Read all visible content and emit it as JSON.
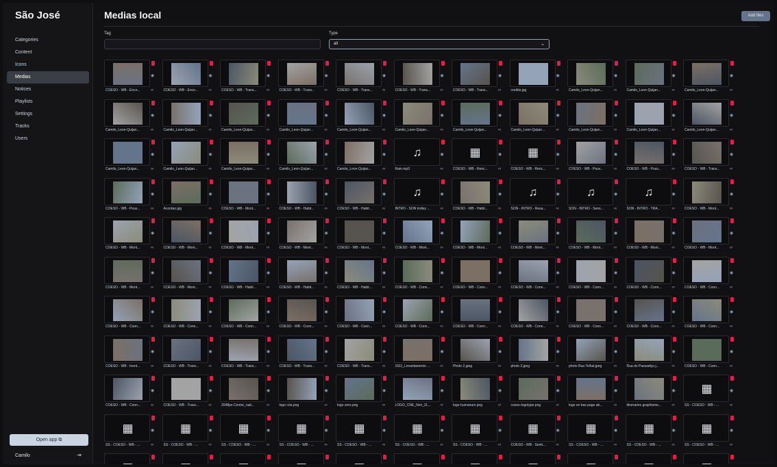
{
  "app": {
    "title": "São José"
  },
  "nav": [
    {
      "label": "Categories",
      "active": false
    },
    {
      "label": "Content",
      "active": false
    },
    {
      "label": "Icons",
      "active": false
    },
    {
      "label": "Medias",
      "active": true
    },
    {
      "label": "Notices",
      "active": false
    },
    {
      "label": "Playlists",
      "active": false
    },
    {
      "label": "Settings",
      "active": false
    },
    {
      "label": "Tracks",
      "active": false
    },
    {
      "label": "Users",
      "active": false
    }
  ],
  "footer": {
    "open_app": "Open app",
    "user": "Camilo"
  },
  "page": {
    "title": "Medias local",
    "add_files": "Add files"
  },
  "filters": {
    "tag_label": "Tag",
    "tag_value": "",
    "type_label": "Type",
    "type_value": "all"
  },
  "media": [
    [
      "COESO - WB - Enco...",
      "COESO - WB - Enco...",
      "COESO - WB - Trans...",
      "COESO - WB - Trans...",
      "COESO - WB - Trans...",
      "COESO - WB - Trans...",
      "COESO - WB - Trans...",
      "credits.jpg",
      "Camilo_Leon-Quijan...",
      "Camilo_Leon-Quijan...",
      "Camilo_Leon-Quijan..."
    ],
    [
      "Camilo_Leon-Quijan...",
      "Camilo_Leon-Quijan...",
      "Camilo_Leon-Quijan...",
      "Camilo_Leon-Quijan...",
      "Camilo_Leon-Quijan...",
      "Camilo_Leon-Quijan...",
      "Camilo_Leon-Quijan...",
      "Camilo_Leon-Quijan...",
      "Camilo_Leon-Quijan...",
      "Camilo_Leon-Quijan...",
      "Camilo_Leon-Quijan..."
    ],
    [
      "Camilo_Leon-Quijan...",
      "Camilo_Leon-Quijan...",
      "Camilo_Leon-Quijan...",
      "Camilo_Leon-Quijan...",
      "Camilo_Leon-Quijan...",
      "Rain.mp3",
      "COESO - WB - Renc...",
      "COESO - WB - Renc...",
      "COESO - WB - Pouv...",
      "COESO - WB - Pouv...",
      "COESO - WB - Trans..."
    ],
    [
      "COESO - WB - Pouv...",
      "Acordao.jpg",
      "COESO - WB - Mont...",
      "COESO - WB - Habit...",
      "COESO - WB - Habit...",
      "INTRO - SON trolley ...",
      "COESO - WB - Habit...",
      "SON - INTRO - Reva...",
      "SON - INTRO - Sens...",
      "SON - INTRO - TRA...",
      "COESO - WB - Mont..."
    ],
    [
      "COESO - WB - Mont...",
      "COESO - WB - Mont...",
      "COESO - WB - Mont...",
      "COESO - WB - Mont...",
      "COESO - WB - Mont...",
      "COESO - WB - Mont...",
      "COESO - WB - Mont...",
      "COESO - WB - Mont...",
      "COESO - WB - Mont...",
      "COESO - WB - Mont...",
      "COESO - WB - Mont..."
    ],
    [
      "COESO - WB - Mont...",
      "COESO - WB - Mont...",
      "COESO - WB - Habit...",
      "COESO - WB - Habit...",
      "COESO - WB - Habit...",
      "COESO - WB - Conn...",
      "COESO - WB - Conn...",
      "COESO - WB - Conn...",
      "COESO - WB - Conn...",
      "COESO - WB - Conn...",
      "COESO - WB - Conn..."
    ],
    [
      "COESO - WB - Conn...",
      "COESO - WB - Conn...",
      "COESO - WB - Conn...",
      "COESO - WB - Conn...",
      "COESO - WB - Conn...",
      "COESO - WB - Conn...",
      "COESO - WB - Conn...",
      "COESO - WB - Conn...",
      "COESO - WB - Conn...",
      "COESO - WB - Conn...",
      "COESO - WB - Conn..."
    ],
    [
      "COESO - WB - Inont...",
      "COESO - WB - Trans...",
      "COESO - WB - Trans...",
      "COESO - WB - Trans...",
      "COESO - WB - Trans...",
      "1911_Levantamento ...",
      "Photo 2.jpeg",
      "photo 3.jpeg",
      "photo Rua Telhal.jpeg",
      "Rua do Passadiço.j...",
      "COESO - WB - Conn..."
    ],
    [
      "COESO - WB - Conn...",
      "COESO - WB - Trans...",
      "2048px-Centre_nati...",
      "logo cria.png",
      "logo zero.png",
      "LOGO_CNE_Noir_2L...",
      "logo-humanum.png",
      "coeso-logotype.png",
      "logo en bas page ab...",
      "itineraries graphisme...",
      "SS - COESO - WB - ..."
    ],
    [
      "SS - COESO - WB - ...",
      "SS - COESO - WB - ...",
      "SS - COESO - WB - ...",
      "SS - COESO - WB - ...",
      "SS - COESO - WB - ...",
      "SS - COESO - WB - ...",
      "SS - COESO - WB - ...",
      "COESO - WB - Senti...",
      "SS - COESO - WB - ...",
      "SS - COESO - WB - ...",
      "SS - COESO - WB - ..."
    ],
    [
      "",
      "",
      "",
      "",
      "",
      "",
      "",
      "",
      "",
      "",
      ""
    ]
  ],
  "colors": {
    "accent": "#e11d48",
    "sidebar_active": "#3a3d45",
    "button": "#cbd5e1"
  }
}
